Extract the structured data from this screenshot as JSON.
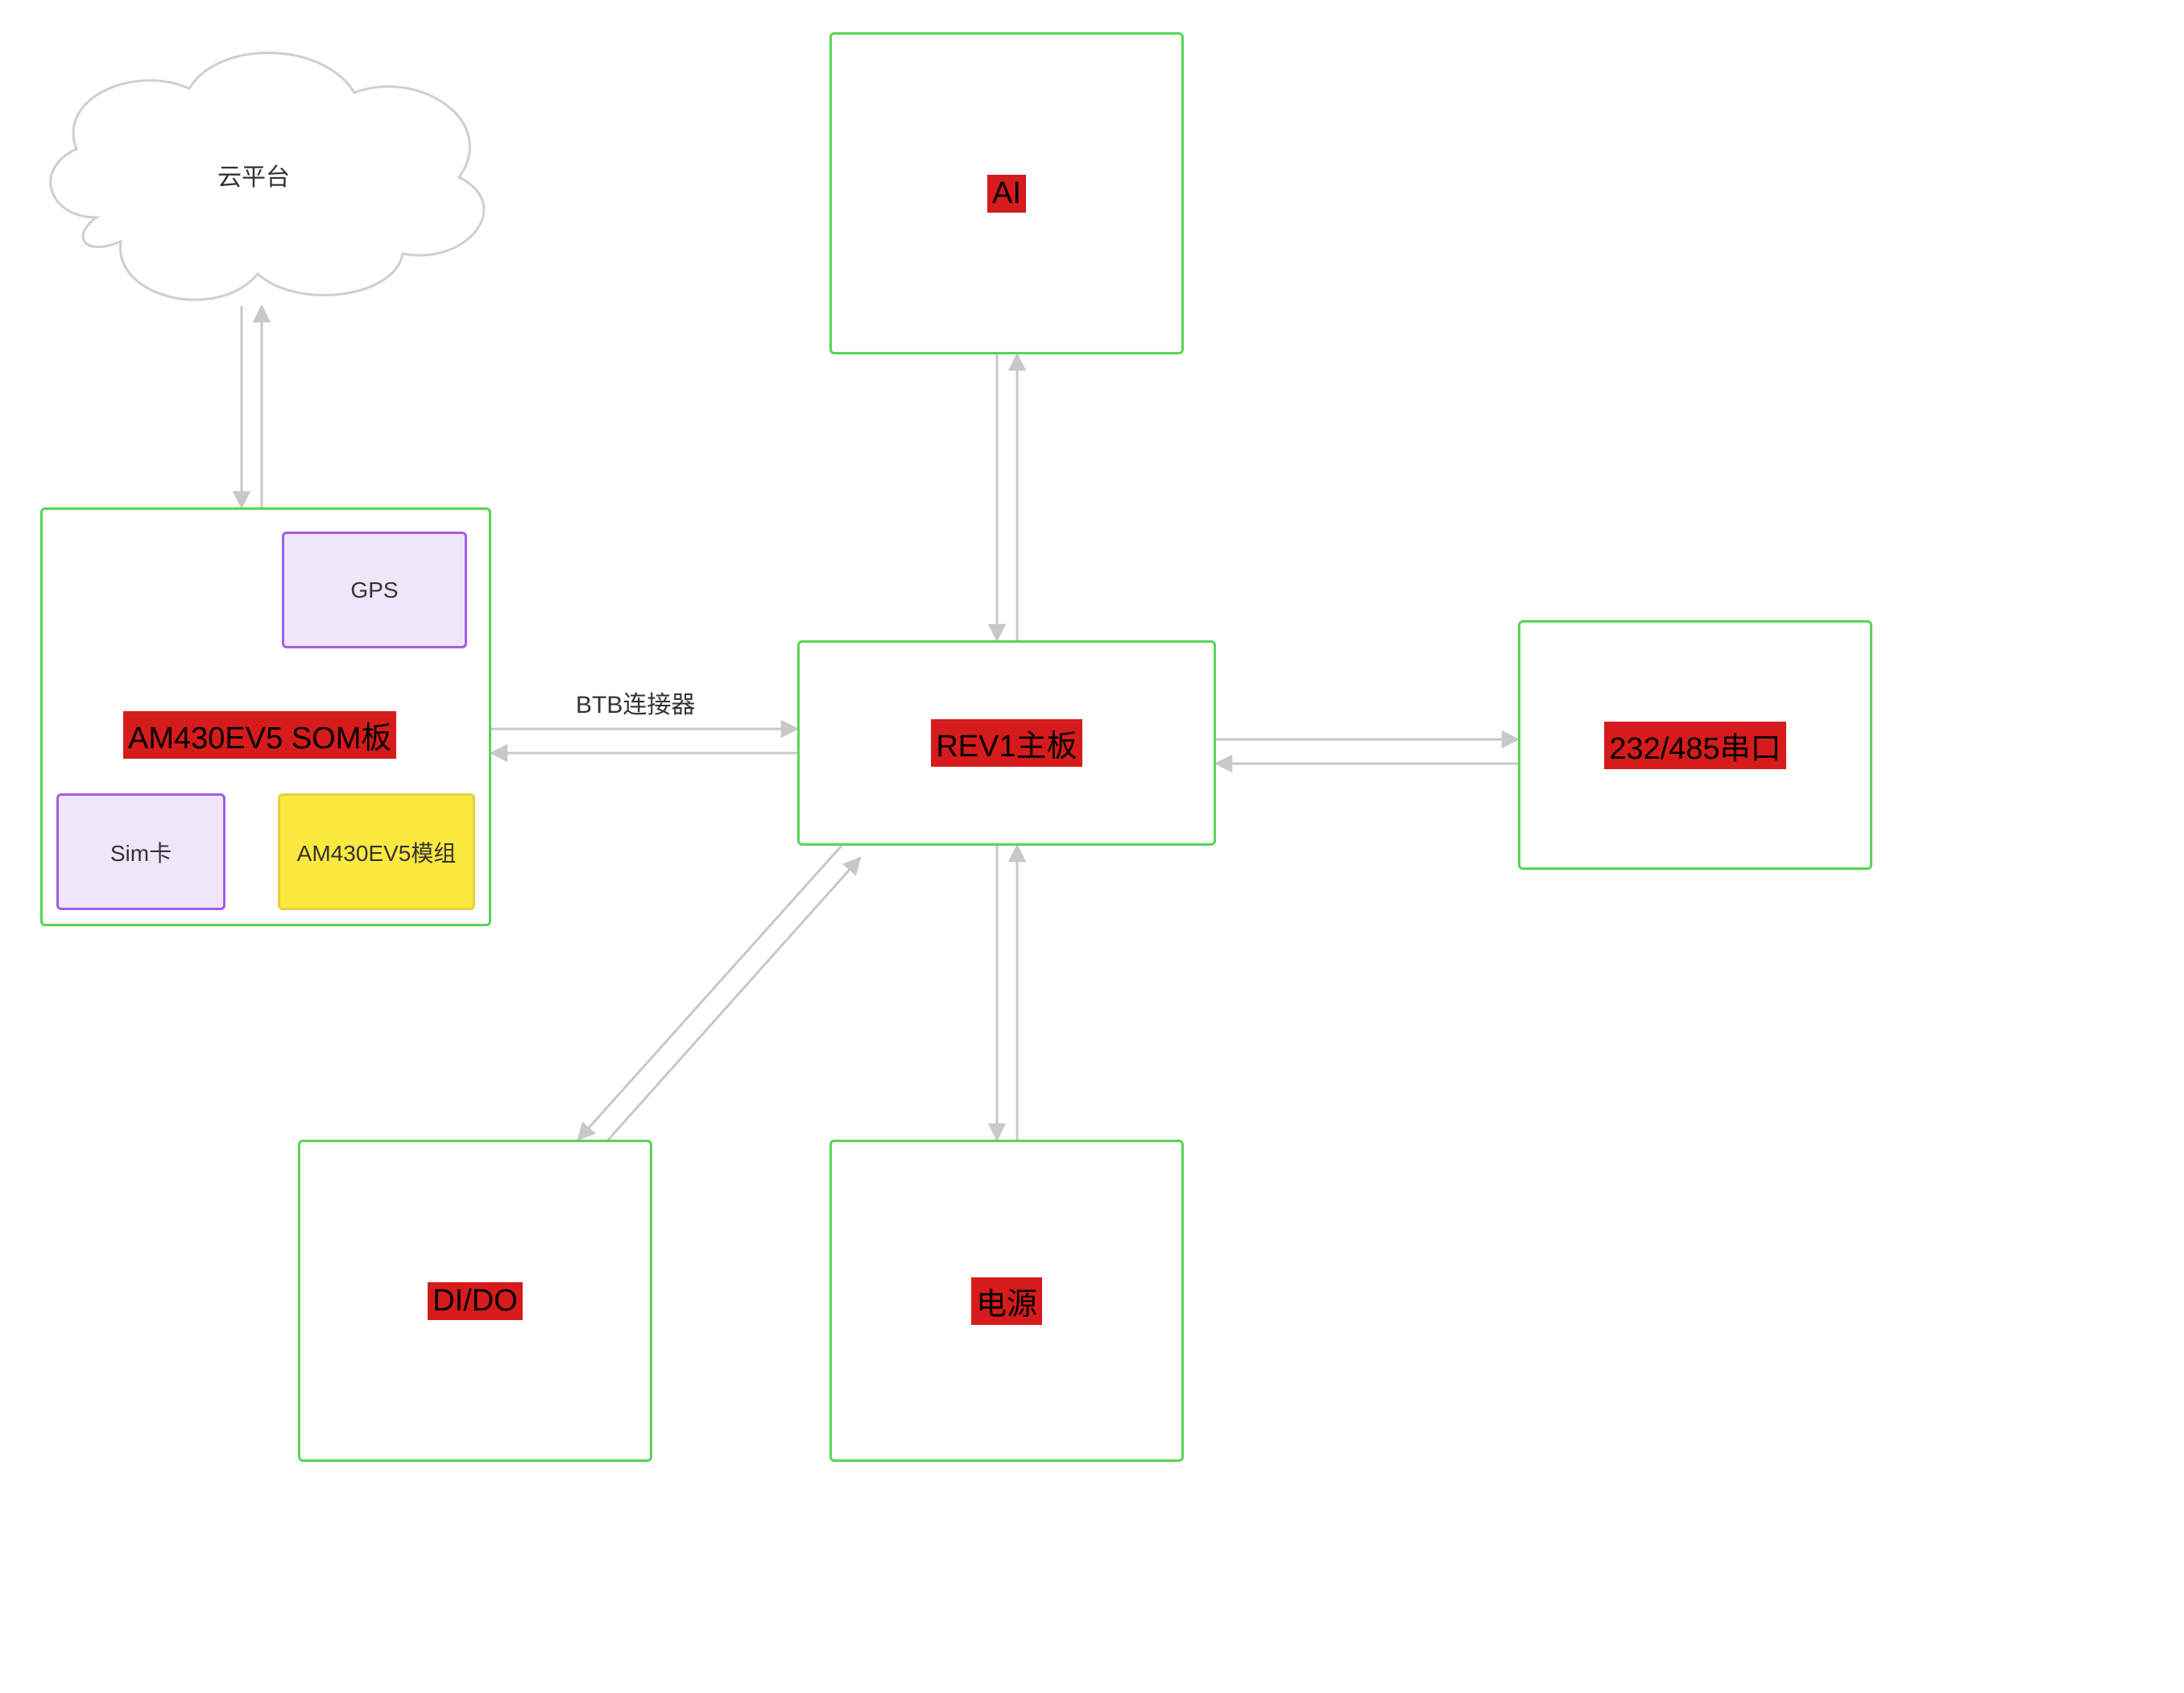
{
  "nodes": {
    "cloud": {
      "label": "云平台"
    },
    "som": {
      "label": "AM430EV5 SOM板"
    },
    "gps": {
      "label": "GPS"
    },
    "sim": {
      "label": "Sim卡"
    },
    "module": {
      "label": "AM430EV5模组"
    },
    "ai": {
      "label": "AI"
    },
    "main": {
      "label": "REV1主板"
    },
    "serial": {
      "label": "232/485串口"
    },
    "dido": {
      "label": "DI/DO"
    },
    "power": {
      "label": "电源"
    }
  },
  "edges": {
    "btb": {
      "label": "BTB连接器"
    }
  },
  "colors": {
    "green": "#57d557",
    "purple": "#a05ee8",
    "purpleFill": "#efe6fb",
    "yellow": "#fce93f",
    "yellowBorder": "#e6d03a",
    "highlight": "#d51b1b",
    "arrow": "#c8c8c8",
    "cloudStroke": "#cfcfcf"
  },
  "diagram_description": "System architecture block diagram. A cloud platform (云平台) bidirectionally connects to an AM430EV5 SOM board which contains a GPS sub-block, a Sim card sub-block, and an AM430EV5 module sub-block (GPS↔module, Sim卡↔module). The SOM board connects via a BTB connector (BTB连接器) to the REV1 main board (REV1主板). The REV1 main board has bidirectional links to: AI (top), 232/485 serial port (right), DI/DO (bottom-left diagonal), and 电源/power (bottom)."
}
